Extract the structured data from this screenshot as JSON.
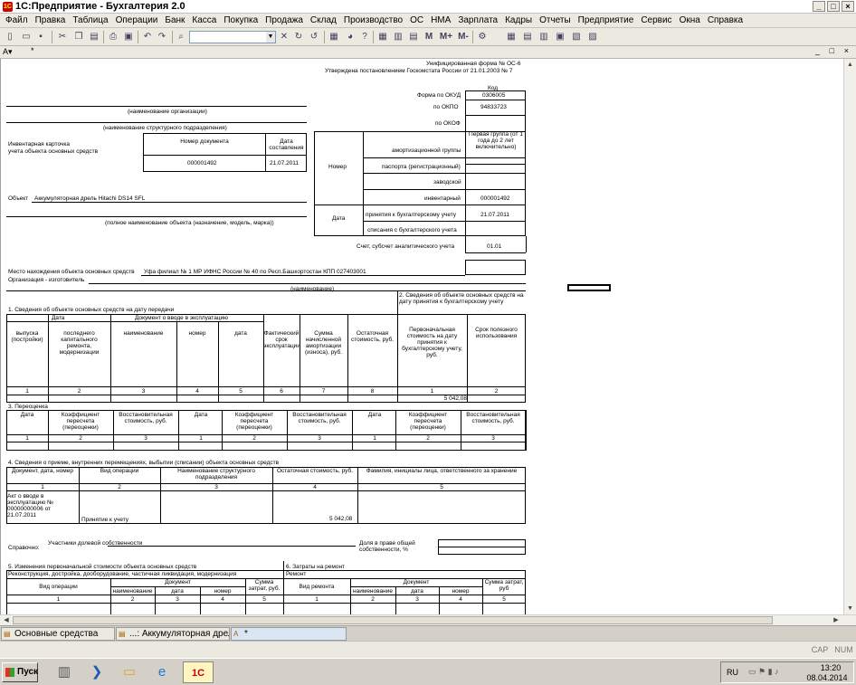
{
  "window": {
    "title": "1С:Предприятие - Бухгалтерия 2.0",
    "app_badge": "1С"
  },
  "window_buttons": [
    "_",
    "□",
    "×"
  ],
  "menu": [
    "Файл",
    "Правка",
    "Таблица",
    "Операции",
    "Банк",
    "Касса",
    "Покупка",
    "Продажа",
    "Склад",
    "Производство",
    "ОС",
    "НМА",
    "Зарплата",
    "Кадры",
    "Отчеты",
    "Предприятие",
    "Сервис",
    "Окна",
    "Справка"
  ],
  "toolbar": {
    "search_value": "",
    "m_buttons": [
      "M",
      "M+",
      "M-"
    ]
  },
  "doc_window": {
    "control_buttons": [
      "_",
      "□",
      "×"
    ]
  },
  "form": {
    "unified_form": "Унифицированная форма № ОС-6",
    "approved": "Утверждена постановлением Госкомстата России от 21.01.2003 № 7",
    "code_header": "Код",
    "okud_label": "Форма по ОКУД",
    "okud_value": "0306005",
    "okpo_label": "по ОКПО",
    "okpo_value": "94833723",
    "okof_label": "по ОКОФ",
    "okof_value": "",
    "org_caption": "(наименование организации)",
    "dept_caption": "(наименование структурного подразделения)",
    "card_title_1": "Инвентарная карточка",
    "card_title_2": "учета объекта основных средств",
    "doc_num_header": "Номер документа",
    "doc_date_header": "Дата составления",
    "doc_num": "000001492",
    "doc_date": "21.07.2011",
    "nomer_label": "Номер",
    "amort_label": "амортизационной группы",
    "amort_value": "Первая группа (от 1 года до 2 лет включительно)",
    "passport_label": "паспорта (регистрационный)",
    "factory_label": "заводской",
    "inventory_label": "инвентарный",
    "inventory_value": "000001492",
    "date_label": "Дата",
    "accept_label": "принятия к бухгалтерскому учету",
    "accept_value": "21.07.2011",
    "writeoff_label": "списания с бухгалтерского учета",
    "account_label": "Счет, субсчет аналитического учета",
    "account_value": "01.01",
    "object_label": "Объект",
    "object_value": "Аккумуляторная дрель Hitachi DS14 SFL",
    "object_caption": "(полное наименование объекта (назначение, модель, марка))",
    "location_label": "Место нахождения объекта основных средств",
    "location_value": "Уфа филиал № 1 МР ИФНС России № 40 по Респ.Башкортостан КПП 027403001",
    "manufacturer_label": "Организация - изготовитель",
    "manufacturer_caption": "(наименование)",
    "s1_title": "1. Сведения об объекте основных средств на дату передачи",
    "s2_title": "2. Сведения об объекте основных средств на дату принятия к бухгалтерскому учету",
    "s1_date": "Дата",
    "s1_doc": "Документ о вводе в эксплуатацию",
    "s1_cols": [
      "выпуска (постройки)",
      "последнего капитального ремонта, модернизации",
      "наименование",
      "номер",
      "дата",
      "Фактический срок эксплуатации",
      "Сумма начисленной амортизации (износа), руб.",
      "Остаточная стоимость, руб."
    ],
    "s2_cols": [
      "Первоначальная стоимость на дату принятия к бухгалтерскому учету, руб.",
      "Срок полезного использования"
    ],
    "s1_nums": [
      "1",
      "2",
      "3",
      "4",
      "5",
      "6",
      "7",
      "8"
    ],
    "s2_nums": [
      "1",
      "2"
    ],
    "s2_cost": "5 042,08",
    "s3_title": "3. Переоценка",
    "s3_cols": [
      "Дата",
      "Коэффициент пересчета (переоценки)",
      "Восстановительная стоимость, руб."
    ],
    "s3_nums": [
      "1",
      "2",
      "3"
    ],
    "s4_title": "4. Сведения о приеме, внутренних перемещениях, выбытии (списании) объекта основных средств",
    "s4_cols": [
      "Документ, дата, номер",
      "Вид операции",
      "Наименование структурного подразделения",
      "Остаточная стоимость, руб.",
      "Фамилия, инициалы лица, ответственного за хранение"
    ],
    "s4_nums": [
      "1",
      "2",
      "3",
      "4",
      "5"
    ],
    "s4_row": {
      "doc": "Акт о вводе в эксплуатацию № 00000000006 от 21.07.2011",
      "op": "Принятие к учету",
      "dept": "",
      "cost": "5 042,08",
      "person": ""
    },
    "ref_label": "Справочно:",
    "share_owners": "Участники долевой собственности",
    "share_right": "Доля в праве общей собственности, %",
    "s5_title": "5. Изменения первоначальной стоимости объекта основных средств",
    "s5_sub": "Реконструкция, достройка, дооборудование, частичная ликвидация, модернизация",
    "s5_cols": [
      "Вид операции",
      "Документ",
      "наименование",
      "дата",
      "номер",
      "Сумма затрат, руб."
    ],
    "s5_nums": [
      "1",
      "2",
      "3",
      "4",
      "5"
    ],
    "s6_title": "6. Затраты на ремонт",
    "s6_sub": "Ремонт",
    "s6_cols": [
      "Вид ремонта",
      "Документ",
      "наименование",
      "дата",
      "номер",
      "Сумма затрат, руб"
    ],
    "s6_nums": [
      "1",
      "2",
      "3",
      "4",
      "5"
    ]
  },
  "tabs": [
    "Основные средства",
    "...: Аккумуляторная дрель ...",
    "*"
  ],
  "status": {
    "cap": "CAP",
    "num": "NUM"
  },
  "taskbar": {
    "start": "Пуск",
    "lang": "RU",
    "time": "13:20",
    "date": "08.04.2014"
  }
}
